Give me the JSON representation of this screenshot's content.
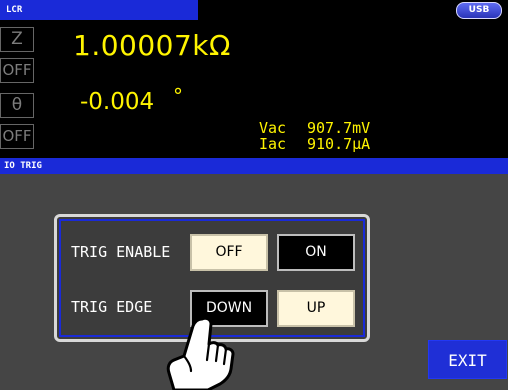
{
  "topbar": {
    "mode": "LCR",
    "usb_badge": "USB"
  },
  "side_buttons": {
    "z": "Z",
    "off1": "OFF",
    "theta": "θ",
    "off2": "OFF"
  },
  "readings": {
    "main": "1.00007kΩ",
    "phase": "-0.004",
    "phase_unit": "°"
  },
  "monitor": {
    "vac_label": "Vac",
    "vac_value": "907.7mV",
    "iac_label": "Iac",
    "iac_value": "910.7μA"
  },
  "section": {
    "title": "IO TRIG"
  },
  "trig": {
    "enable_label": "TRIG ENABLE",
    "enable_off": "OFF",
    "enable_on": "ON",
    "edge_label": "TRIG EDGE",
    "edge_down": "DOWN",
    "edge_up": "UP"
  },
  "exit_label": "EXIT",
  "colors": {
    "accent_blue": "#1a2ad8",
    "reading_yellow": "#fff400",
    "button_cream": "#fff7dc"
  }
}
